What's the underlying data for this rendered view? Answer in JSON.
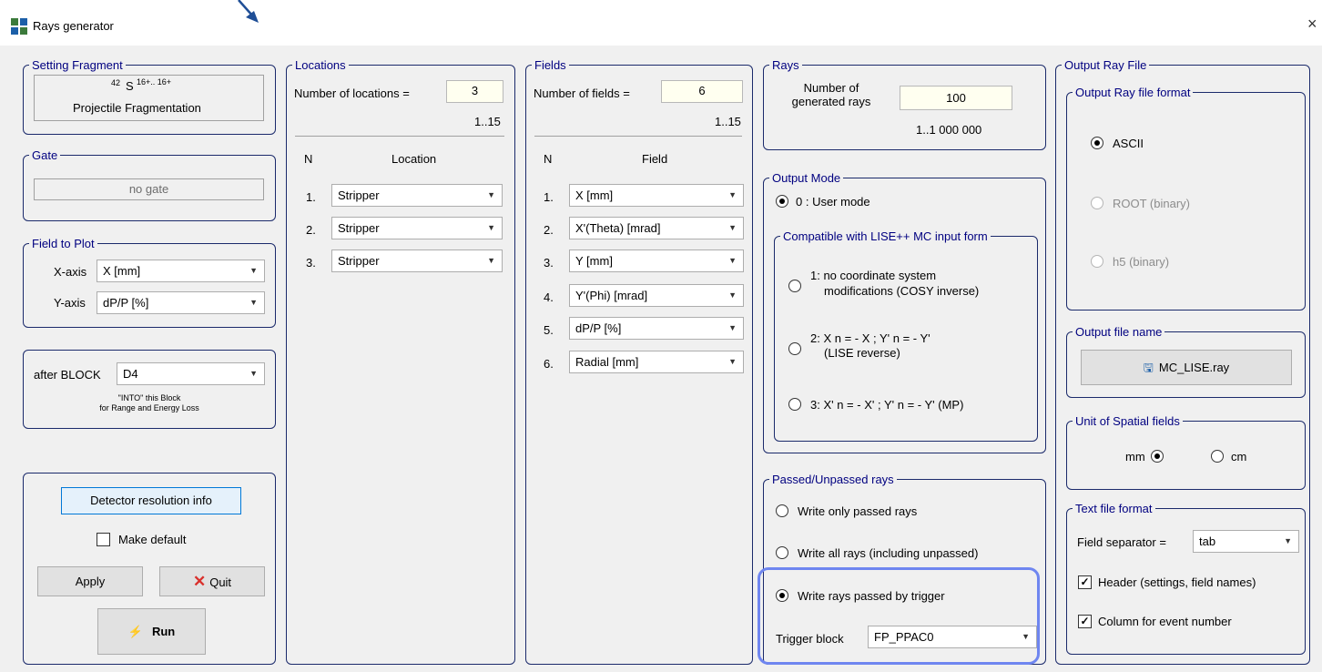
{
  "window": {
    "title": "Rays generator",
    "close_glyph": "×"
  },
  "setting_fragment": {
    "legend": "Setting Fragment",
    "isotope_mass": "42",
    "isotope_symbol": "S",
    "isotope_charge": "16+.. 16+",
    "reaction": "Projectile Fragmentation"
  },
  "gate": {
    "legend": "Gate",
    "value": "no gate"
  },
  "field_to_plot": {
    "legend": "Field to Plot",
    "x_label": "X-axis",
    "x_value": "X [mm]",
    "y_label": "Y-axis",
    "y_value": "dP/P [%]"
  },
  "block": {
    "label": "after BLOCK",
    "value": "D4",
    "note_line1": "\"INTO\" this Block",
    "note_line2": "for Range and Energy Loss"
  },
  "actions": {
    "detector_info": "Detector resolution info",
    "make_default": "Make default",
    "apply": "Apply",
    "quit": "Quit",
    "run": "Run"
  },
  "locations": {
    "legend": "Locations",
    "count_label": "Number of locations =",
    "count": "3",
    "range": "1..15",
    "col_n": "N",
    "col_name": "Location",
    "rows": [
      {
        "n": "1.",
        "value": "Stripper"
      },
      {
        "n": "2.",
        "value": "Stripper"
      },
      {
        "n": "3.",
        "value": "Stripper"
      }
    ]
  },
  "fields": {
    "legend": "Fields",
    "count_label": "Number of fields =",
    "count": "6",
    "range": "1..15",
    "col_n": "N",
    "col_name": "Field",
    "rows": [
      {
        "n": "1.",
        "value": "X [mm]"
      },
      {
        "n": "2.",
        "value": "X'(Theta) [mrad]"
      },
      {
        "n": "3.",
        "value": "Y [mm]"
      },
      {
        "n": "4.",
        "value": "Y'(Phi) [mrad]"
      },
      {
        "n": "5.",
        "value": "dP/P [%]"
      },
      {
        "n": "6.",
        "value": "Radial [mm]"
      }
    ]
  },
  "rays": {
    "legend": "Rays",
    "count_label_1": "Number of",
    "count_label_2": "generated rays",
    "count": "100",
    "range": "1..1 000 000"
  },
  "output_mode": {
    "legend": "Output Mode",
    "user_mode": "0 : User mode",
    "compat_legend": "Compatible with LISE++ MC input form",
    "opt1_line1": "1: no coordinate system",
    "opt1_line2": "modifications (COSY inverse)",
    "opt2_line1": "2:  X n = - X ;  Y' n = - Y'",
    "opt2_line2": "(LISE reverse)",
    "opt3": "3:  X' n = - X' ;   Y' n = - Y'   (MP)"
  },
  "passed": {
    "legend": "Passed/Unpassed rays",
    "opt1": "Write only passed rays",
    "opt2": "Write all rays (including unpassed)",
    "opt3": "Write rays passed by trigger",
    "trigger_label": "Trigger block",
    "trigger_value": "FP_PPAC0"
  },
  "output_file": {
    "legend": "Output Ray File",
    "format_legend": "Output Ray file format",
    "ascii": "ASCII",
    "root": "ROOT (binary)",
    "h5": "h5 (binary)",
    "name_legend": "Output file name",
    "file_name": "MC_LISE.ray",
    "unit_legend": "Unit of Spatial fields",
    "unit_mm": "mm",
    "unit_cm": "cm",
    "text_legend": "Text file format",
    "sep_label": "Field separator =",
    "sep_value": "tab",
    "header_opt": "Header (settings, field names)",
    "column_opt": "Column for event number"
  },
  "colors": {
    "highlight": "#6f86f0",
    "legend_text": "#000080",
    "arrow": "#1f4e96"
  }
}
